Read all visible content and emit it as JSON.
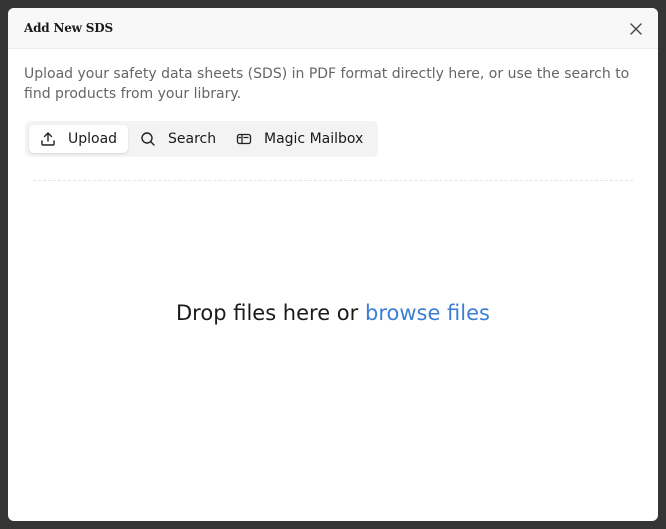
{
  "dialog": {
    "title": "Add New SDS",
    "description": "Upload your safety data sheets (SDS) in PDF format directly here, or use the search to find products from your library."
  },
  "tabs": [
    {
      "label": "Upload",
      "icon": "upload-icon",
      "active": true
    },
    {
      "label": "Search",
      "icon": "search-icon",
      "active": false
    },
    {
      "label": "Magic Mailbox",
      "icon": "mailbox-icon",
      "active": false
    }
  ],
  "dropzone": {
    "prompt": "Drop files here or",
    "link": "browse files"
  },
  "colors": {
    "link": "#3b7fd4",
    "backdrop": "#353535",
    "tab_bar": "#f3f3f3"
  }
}
